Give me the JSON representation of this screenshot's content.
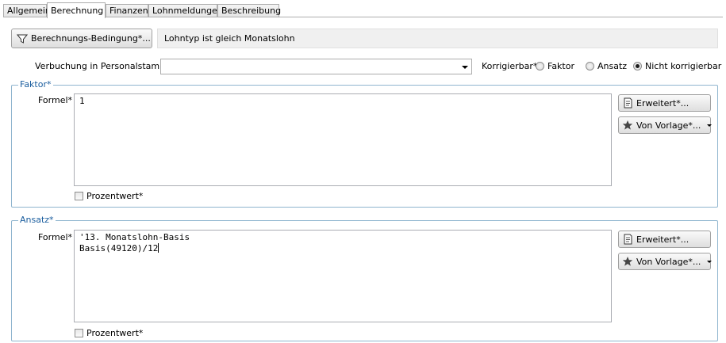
{
  "tabs": [
    {
      "label": "Allgemein"
    },
    {
      "label": "Berechnung"
    },
    {
      "label": "Finanzen"
    },
    {
      "label": "Lohnmeldungen"
    },
    {
      "label": "Beschreibung"
    }
  ],
  "condition": {
    "button_label": "Berechnungs-Bedingung*...",
    "display_text": "Lohntyp ist gleich Monatslohn"
  },
  "booking": {
    "label": "Verbuchung in Personalstamm*:",
    "value": ""
  },
  "correctable": {
    "label": "Korrigierbar* :",
    "options": [
      {
        "label": "Faktor",
        "checked": false
      },
      {
        "label": "Ansatz",
        "checked": false
      },
      {
        "label": "Nicht korrigierbar",
        "checked": true
      }
    ]
  },
  "faktor": {
    "title": "Faktor*",
    "formula_label": "Formel* :",
    "formula": "1",
    "percent_label": "Prozentwert*",
    "advanced_label": "Erweitert*...",
    "template_label": "Von Vorlage*..."
  },
  "ansatz": {
    "title": "Ansatz*",
    "formula_label": "Formel* :",
    "formula": "'13. Monatslohn-Basis\nBasis(49120)/12",
    "percent_label": "Prozentwert*",
    "advanced_label": "Erweitert*...",
    "template_label": "Von Vorlage*..."
  },
  "icons": {
    "filter": "filter-icon",
    "advanced": "edit-document-icon",
    "template": "star-icon"
  }
}
